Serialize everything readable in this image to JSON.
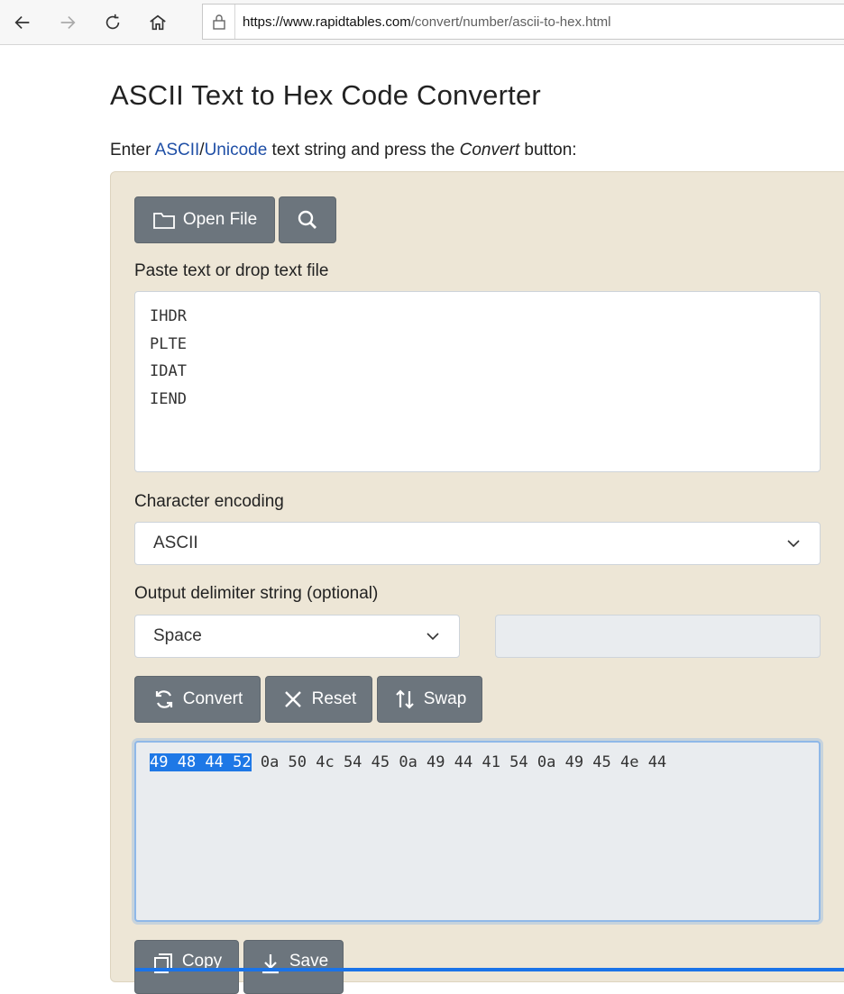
{
  "browser": {
    "url_host": "https://www.rapidtables.com",
    "url_path": "/convert/number/ascii-to-hex.html"
  },
  "page": {
    "title": "ASCII Text to Hex Code Converter",
    "intro_prefix": "Enter ",
    "intro_link_ascii": "ASCII",
    "intro_slash": "/",
    "intro_link_unicode": "Unicode",
    "intro_middle": " text string and press the ",
    "intro_em": "Convert",
    "intro_suffix": " button:"
  },
  "toolbar": {
    "open_file_label": "Open File"
  },
  "input": {
    "label": "Paste text or drop text file",
    "lines": [
      "IHDR",
      "PLTE",
      "IDAT",
      "IEND"
    ]
  },
  "encoding": {
    "label": "Character encoding",
    "selected": "ASCII"
  },
  "delimiter": {
    "label": "Output delimiter string (optional)",
    "selected": "Space"
  },
  "actions": {
    "convert_label": "Convert",
    "reset_label": "Reset",
    "swap_label": "Swap"
  },
  "output": {
    "selected_text": "49 48 44 52",
    "rest_text": " 0a 50 4c 54 45 0a 49 44 41 54 0a 49 45 4e 44"
  },
  "bottom_actions": {
    "copy_label": "Copy",
    "save_label": "Save"
  },
  "colors": {
    "panel_bg": "#ede6d6",
    "button_bg": "#6c757d",
    "link": "#1f4fa6",
    "selection": "#1e78e6"
  }
}
